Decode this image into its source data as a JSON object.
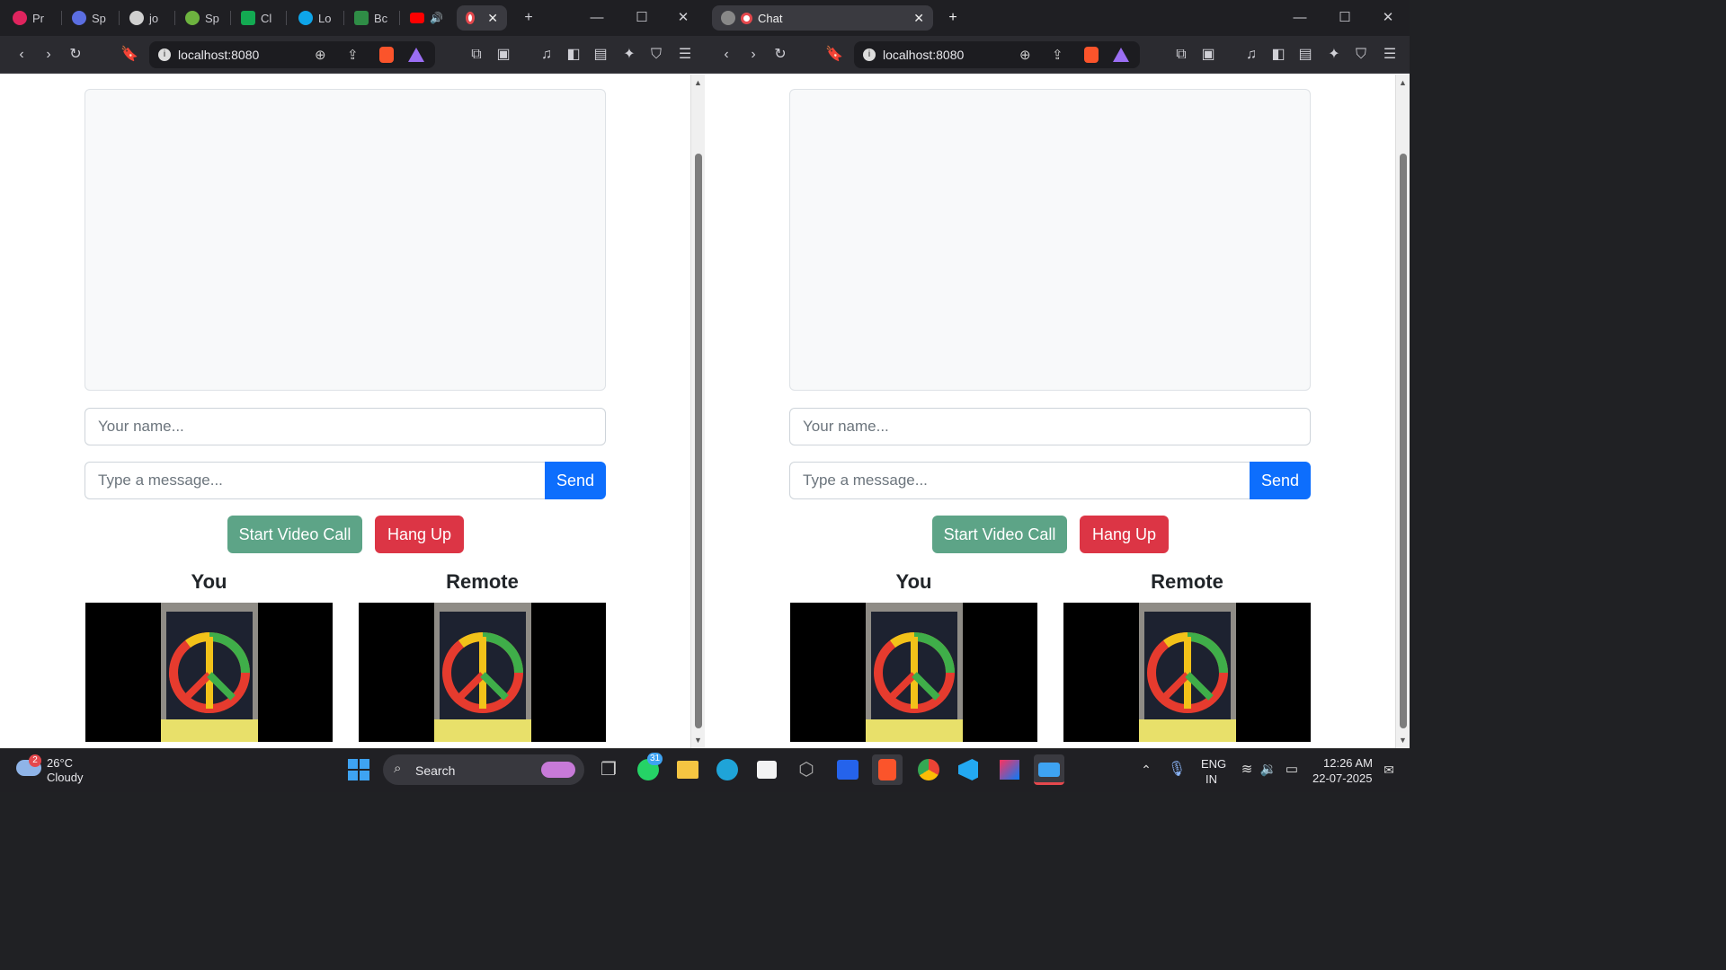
{
  "left_window": {
    "tabs": [
      {
        "label": "Pr",
        "color": "#e0245e"
      },
      {
        "label": "Sp",
        "color": "#5b6ee1"
      },
      {
        "label": "jo",
        "color": "#d0d0d0"
      },
      {
        "label": "Sp",
        "color": "#6db33f"
      },
      {
        "label": "Cl",
        "color": "#13aa52"
      },
      {
        "label": "Lo",
        "color": "#0ea5e9"
      },
      {
        "label": "Bc",
        "color": "#2f8d46"
      }
    ],
    "url": "localhost:8080"
  },
  "right_window": {
    "tab_title": "Chat",
    "url": "localhost:8080"
  },
  "app": {
    "name_placeholder": "Your name...",
    "message_placeholder": "Type a message...",
    "send_label": "Send",
    "start_call_label": "Start Video Call",
    "hang_up_label": "Hang Up",
    "you_label": "You",
    "remote_label": "Remote"
  },
  "colors": {
    "send": "#0d6efd",
    "start_call": "#5da487",
    "hang_up": "#dc3545"
  },
  "taskbar": {
    "weather_temp": "26°C",
    "weather_desc": "Cloudy",
    "weather_badge": "2",
    "search_label": "Search",
    "whatsapp_badge": "31",
    "lang_top": "ENG",
    "lang_bottom": "IN",
    "time": "12:26 AM",
    "date": "22-07-2025"
  }
}
